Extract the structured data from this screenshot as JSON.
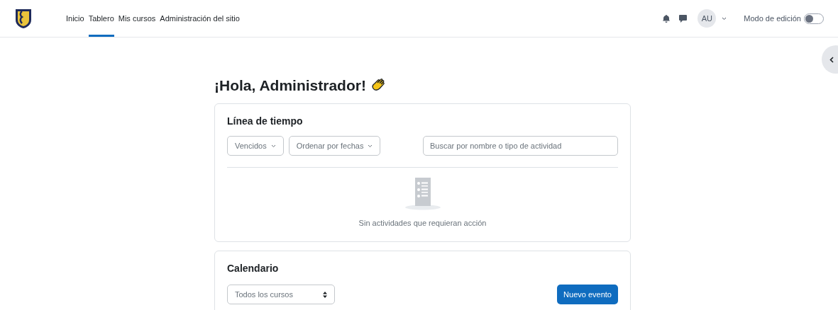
{
  "nav": {
    "links": [
      {
        "label": "Inicio",
        "selected": false
      },
      {
        "label": "Tablero",
        "selected": true
      },
      {
        "label": "Mis cursos",
        "selected": false
      },
      {
        "label": "Administración del sitio",
        "selected": false
      }
    ],
    "avatar": "AU",
    "edit_mode": {
      "label": "Modo de edición",
      "on": false
    }
  },
  "greeting": "¡Hola, Administrador!",
  "timeline": {
    "title": "Línea de tiempo",
    "filters": [
      "Vencidos",
      "Ordenar por fechas"
    ],
    "search": {
      "placeholder": "Buscar por nombre o tipo de actividad"
    },
    "empty_message": "Sin actividades que requieran acción"
  },
  "calendar": {
    "title": "Calendario",
    "course_select": "Todos los cursos",
    "button": "Nuevo evento"
  }
}
